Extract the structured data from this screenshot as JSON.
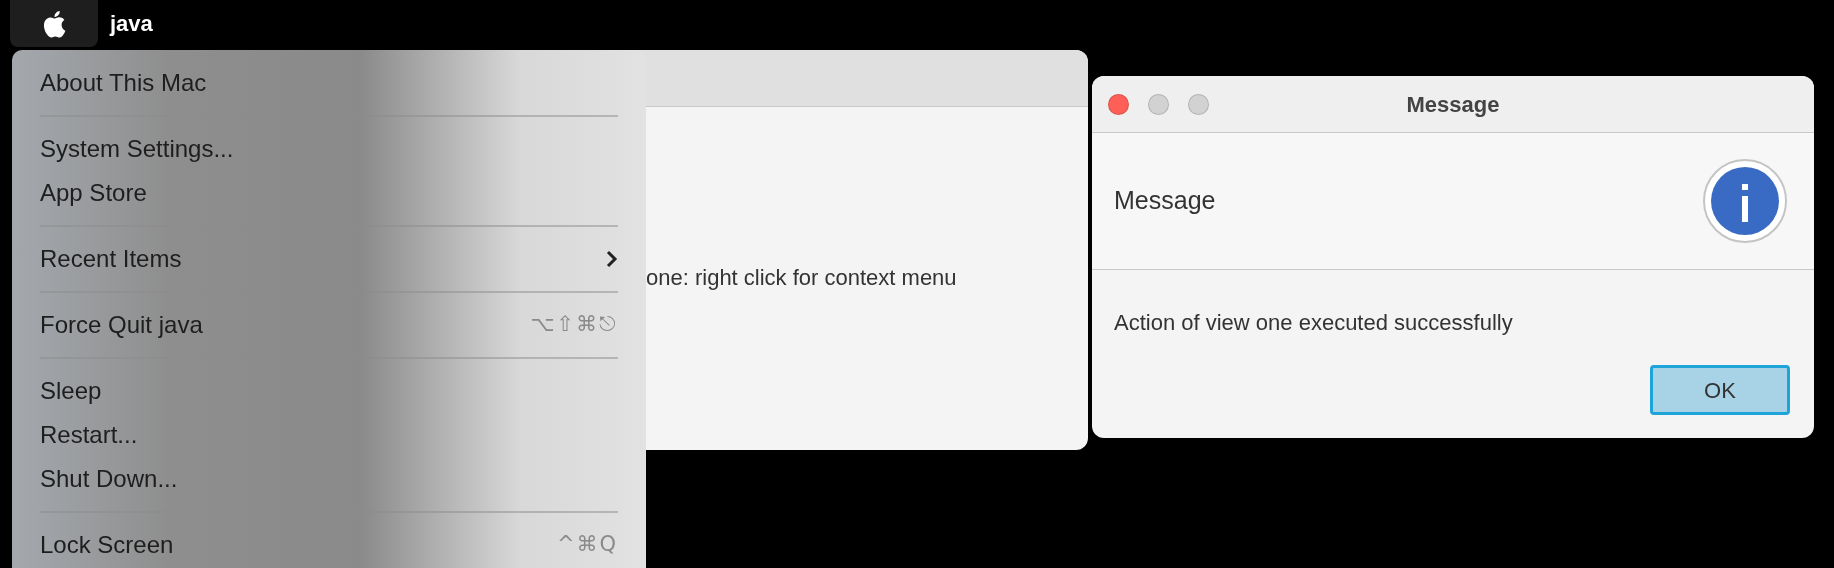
{
  "menu_bar": {
    "app_name": "java"
  },
  "apple_menu": {
    "groups": [
      [
        {
          "label": "About This Mac"
        }
      ],
      [
        {
          "label": "System Settings..."
        },
        {
          "label": "App Store"
        }
      ],
      [
        {
          "label": "Recent Items",
          "submenu": true
        }
      ],
      [
        {
          "label": "Force Quit java",
          "shortcut": "⌥⇧⌘⎋"
        }
      ],
      [
        {
          "label": "Sleep"
        },
        {
          "label": "Restart..."
        },
        {
          "label": "Shut Down..."
        }
      ],
      [
        {
          "label": "Lock Screen",
          "shortcut": "^⌘Q"
        }
      ]
    ]
  },
  "back_window": {
    "label": "one: right click for context menu"
  },
  "dialog": {
    "title": "Message",
    "header": "Message",
    "message": "Action of view one executed successfully",
    "buttons": [
      {
        "label": "OK",
        "default": true
      }
    ]
  }
}
